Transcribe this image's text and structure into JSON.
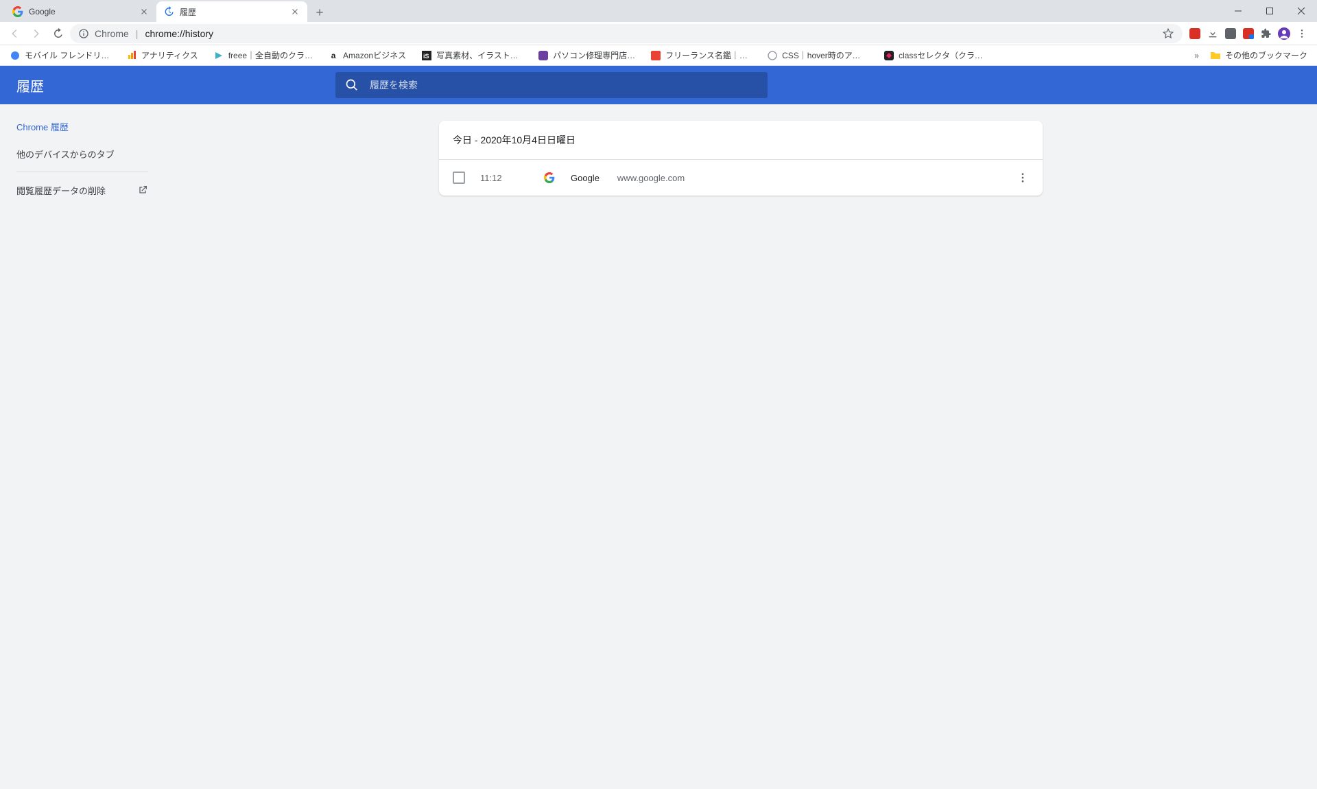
{
  "tabs": [
    {
      "title": "Google",
      "active": false,
      "icon": "google"
    },
    {
      "title": "履歴",
      "active": true,
      "icon": "history-blue"
    }
  ],
  "omnibox": {
    "prefix": "Chrome",
    "url": "chrome://history"
  },
  "bookmarks": [
    {
      "label": "モバイル フレンドリー テ…"
    },
    {
      "label": "アナリティクス"
    },
    {
      "label": "freee｜全自動のクラ…"
    },
    {
      "label": "Amazonビジネス"
    },
    {
      "label": "写真素材、イラスト、…"
    },
    {
      "label": "パソコン修理専門店…"
    },
    {
      "label": "フリーランス名鑑｜国…"
    },
    {
      "label": "CSS｜hover時のアン…"
    },
    {
      "label": "classセレクタ（クラス…"
    }
  ],
  "bookmarks_other": "その他のブックマーク",
  "app": {
    "title": "履歴",
    "search_placeholder": "履歴を検索",
    "sidebar": {
      "chrome_history": "Chrome 履歴",
      "other_tabs": "他のデバイスからのタブ",
      "clear_data": "閲覧履歴データの削除"
    },
    "section_header": "今日 - 2020年10月4日日曜日",
    "entries": [
      {
        "time": "11:12",
        "title": "Google",
        "domain": "www.google.com"
      }
    ]
  }
}
